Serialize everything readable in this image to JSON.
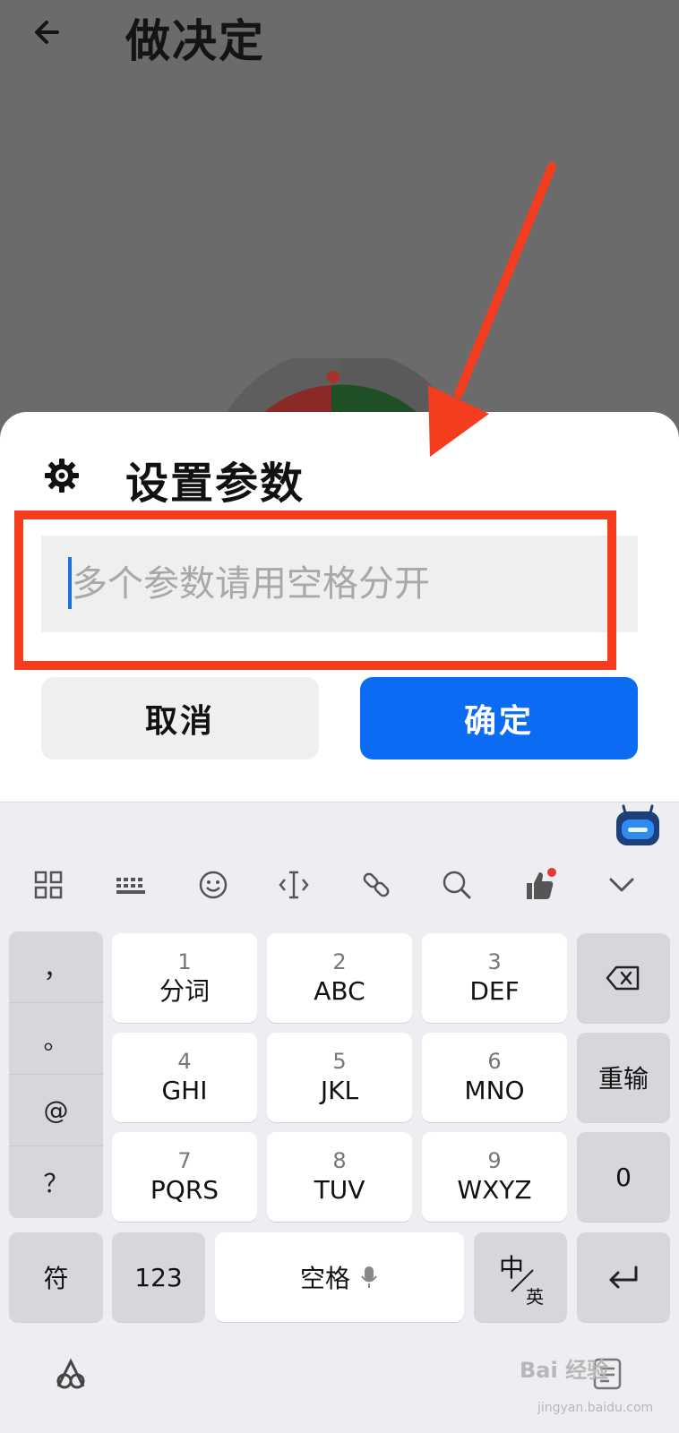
{
  "app": {
    "title": "做决定"
  },
  "dialog": {
    "title": "设置参数",
    "input_placeholder": "多个参数请用空格分开",
    "input_value": "",
    "cancel_label": "取消",
    "confirm_label": "确定"
  },
  "keyboard": {
    "toolbar": [
      "grid-icon",
      "keyboard-icon",
      "emoji-icon",
      "cursor-icon",
      "link-icon",
      "search-icon",
      "thumbs-up-icon",
      "chevron-down-icon"
    ],
    "punctuation": [
      "，",
      "。",
      "@",
      "？"
    ],
    "keys": [
      {
        "num": "1",
        "letters": "分词"
      },
      {
        "num": "2",
        "letters": "ABC"
      },
      {
        "num": "3",
        "letters": "DEF"
      },
      {
        "num": "4",
        "letters": "GHI"
      },
      {
        "num": "5",
        "letters": "JKL"
      },
      {
        "num": "6",
        "letters": "MNO"
      },
      {
        "num": "7",
        "letters": "PQRS"
      },
      {
        "num": "8",
        "letters": "TUV"
      },
      {
        "num": "9",
        "letters": "WXYZ"
      }
    ],
    "retype_label": "重输",
    "zero_label": "0",
    "symbol_label": "符",
    "num_label": "123",
    "space_label": "空格",
    "lang_top": "中",
    "lang_bottom": "英"
  },
  "watermark": {
    "text": "Bai 经验",
    "sub": "jingyan.baidu.com"
  },
  "colors": {
    "accent": "#0b6cf3",
    "annotation": "#f43c1f",
    "overlay": "#6b6b6b"
  }
}
